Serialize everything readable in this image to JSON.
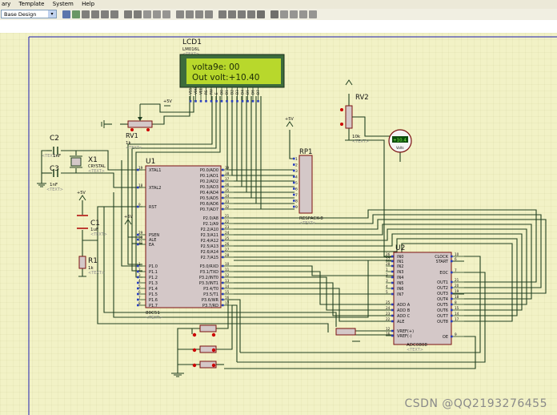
{
  "menubar": {
    "items": [
      "ary",
      "Template",
      "System",
      "Help"
    ]
  },
  "toolbar": {
    "template_value": "Base Design",
    "icons": [
      "wire-tool-icon",
      "add-icon",
      "zoom-in-icon",
      "zoom-out-icon",
      "zoom-fit-icon",
      "zoom-area-icon",
      "undo-icon",
      "redo-icon",
      "cut-icon",
      "copy-icon",
      "paste-icon",
      "block-copy-icon",
      "block-move-icon",
      "block-rotate-icon",
      "block-delete-icon",
      "pick-device-icon",
      "make-device-icon",
      "package-tool-icon",
      "decompose-icon",
      "wire-autorouter-icon",
      "search-icon",
      "property-tool-icon",
      "new-sheet-icon",
      "remove-sheet-icon",
      "netlist-icon"
    ]
  },
  "lcd": {
    "ref": "LCD1",
    "model": "LM016L",
    "text_tag": "<TEXT>",
    "line1": "volta9e: 00",
    "line2": "Out volt:+10.40",
    "pins": [
      "VSS",
      "VDD",
      "VEE",
      "RS",
      "RW",
      "E",
      "D0",
      "D1",
      "D2",
      "D3",
      "D4",
      "D5",
      "D6",
      "D7"
    ]
  },
  "pot1": {
    "ref": "RV1",
    "value": "1k",
    "text_tag": "<TEXT>"
  },
  "pot2": {
    "ref": "RV2",
    "value": "10k",
    "text_tag": "<TEXT>"
  },
  "voltmeter": {
    "reading": "+10.4",
    "unit": "Volts"
  },
  "cap_c2": {
    "ref": "C2",
    "value": "1nF",
    "text_tag": "<TEXT>"
  },
  "cap_c3": {
    "ref": "C3",
    "value": "1nF",
    "text_tag": "<TEXT>"
  },
  "crystal": {
    "ref": "X1",
    "model": "CRYSTAL",
    "text_tag": "<TEXT>"
  },
  "cap_c1": {
    "ref": "C1",
    "value": "1uF",
    "text_tag": "<TEXT>"
  },
  "res_r1": {
    "ref": "R1",
    "value": "1k",
    "text_tag": "<TEXT>"
  },
  "power_5v": "+5V",
  "mcu": {
    "ref": "U1",
    "model": "80C51",
    "text_tag": "<TEXT>",
    "left_pins": [
      {
        "num": "19",
        "name": "XTAL1"
      },
      {
        "num": "18",
        "name": "XTAL2"
      },
      {
        "num": "9",
        "name": "RST"
      },
      {
        "num": "29",
        "name": "PSEN"
      },
      {
        "num": "30",
        "name": "ALE"
      },
      {
        "num": "31",
        "name": "EA"
      },
      {
        "num": "1",
        "name": "P1.0"
      },
      {
        "num": "2",
        "name": "P1.1"
      },
      {
        "num": "3",
        "name": "P1.2"
      },
      {
        "num": "4",
        "name": "P1.3"
      },
      {
        "num": "5",
        "name": "P1.4"
      },
      {
        "num": "6",
        "name": "P1.5"
      },
      {
        "num": "7",
        "name": "P1.6"
      },
      {
        "num": "8",
        "name": "P1.7"
      }
    ],
    "right_pins": [
      {
        "num": "39",
        "name": "P0.0/AD0"
      },
      {
        "num": "38",
        "name": "P0.1/AD1"
      },
      {
        "num": "37",
        "name": "P0.2/AD2"
      },
      {
        "num": "36",
        "name": "P0.3/AD3"
      },
      {
        "num": "35",
        "name": "P0.4/AD4"
      },
      {
        "num": "34",
        "name": "P0.5/AD5"
      },
      {
        "num": "33",
        "name": "P0.6/AD6"
      },
      {
        "num": "32",
        "name": "P0.7/AD7"
      },
      {
        "num": "21",
        "name": "P2.0/A8"
      },
      {
        "num": "22",
        "name": "P2.1/A9"
      },
      {
        "num": "23",
        "name": "P2.2/A10"
      },
      {
        "num": "24",
        "name": "P2.3/A11"
      },
      {
        "num": "25",
        "name": "P2.4/A12"
      },
      {
        "num": "26",
        "name": "P2.5/A13"
      },
      {
        "num": "27",
        "name": "P2.6/A14"
      },
      {
        "num": "28",
        "name": "P2.7/A15"
      },
      {
        "num": "10",
        "name": "P3.0/RXD"
      },
      {
        "num": "11",
        "name": "P3.1/TXD"
      },
      {
        "num": "12",
        "name": "P3.2/INT0"
      },
      {
        "num": "13",
        "name": "P3.3/INT1"
      },
      {
        "num": "14",
        "name": "P3.4/T0"
      },
      {
        "num": "15",
        "name": "P3.5/T1"
      },
      {
        "num": "16",
        "name": "P3.6/WR"
      },
      {
        "num": "17",
        "name": "P3.7/RD"
      }
    ]
  },
  "respack": {
    "ref": "RP1",
    "model": "RESPACK-8",
    "text_tag": "<TEXT>",
    "pins": [
      "1",
      "2",
      "3",
      "4",
      "5",
      "6",
      "7",
      "8",
      "9"
    ]
  },
  "adc": {
    "ref": "U2",
    "model": "ADC0808",
    "text_tag": "<TEXT>",
    "left_pins": [
      {
        "num": "26",
        "name": "IN0"
      },
      {
        "num": "27",
        "name": "IN1"
      },
      {
        "num": "28",
        "name": "IN2"
      },
      {
        "num": "1",
        "name": "IN3"
      },
      {
        "num": "2",
        "name": "IN4"
      },
      {
        "num": "3",
        "name": "IN5"
      },
      {
        "num": "4",
        "name": "IN6"
      },
      {
        "num": "5",
        "name": "IN7"
      },
      {
        "num": "25",
        "name": "ADD A"
      },
      {
        "num": "24",
        "name": "ADD B"
      },
      {
        "num": "23",
        "name": "ADD C"
      },
      {
        "num": "22",
        "name": "ALE"
      },
      {
        "num": "12",
        "name": "VREF(+)"
      },
      {
        "num": "16",
        "name": "VREF(-)"
      }
    ],
    "right_pins": [
      {
        "num": "10",
        "name": "CLOCK"
      },
      {
        "num": "6",
        "name": "START"
      },
      {
        "num": "7",
        "name": "EOC"
      },
      {
        "num": "21",
        "name": "OUT1"
      },
      {
        "num": "20",
        "name": "OUT2"
      },
      {
        "num": "19",
        "name": "OUT3"
      },
      {
        "num": "18",
        "name": "OUT4"
      },
      {
        "num": "8",
        "name": "OUT5"
      },
      {
        "num": "15",
        "name": "OUT6"
      },
      {
        "num": "14",
        "name": "OUT7"
      },
      {
        "num": "17",
        "name": "OUT8"
      },
      {
        "num": "9",
        "name": "OE"
      }
    ]
  },
  "watermark": "CSDN @QQ2193276455"
}
